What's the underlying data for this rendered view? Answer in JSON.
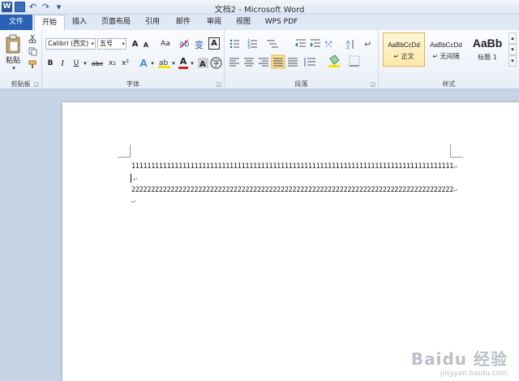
{
  "window": {
    "title": "文档2 - Microsoft Word"
  },
  "qat": {
    "logo": "W",
    "undo": "↶",
    "redo": "↷",
    "more": "▾"
  },
  "tabs": [
    {
      "label": "文件"
    },
    {
      "label": "开始"
    },
    {
      "label": "插入"
    },
    {
      "label": "页面布局"
    },
    {
      "label": "引用"
    },
    {
      "label": "邮件"
    },
    {
      "label": "审阅"
    },
    {
      "label": "视图"
    },
    {
      "label": "WPS PDF"
    }
  ],
  "ribbon": {
    "clipboard": {
      "label": "剪贴板",
      "paste_label": "粘贴"
    },
    "font": {
      "label": "字体",
      "font_name": "Calibri (西文)",
      "font_size": "五号",
      "grow": "A",
      "shrink": "A",
      "case": "Aa",
      "bold": "B",
      "italic": "I",
      "underline": "U",
      "strike": "abc",
      "subscript": "x₂",
      "superscript": "x²",
      "text_effect": "A",
      "font_color": "A"
    },
    "paragraph": {
      "label": "段落"
    },
    "styles": {
      "label": "样式",
      "items": [
        {
          "sample": "AaBbCcDd",
          "name": "↵ 正文"
        },
        {
          "sample": "AaBbCcDd",
          "name": "↵ 无间隔"
        },
        {
          "sample": "AaBb",
          "name": "标题 1"
        }
      ]
    }
  },
  "document": {
    "line1": "1111111111111111111111111111111111111111111111111111111111111111111111111111111111",
    "line2": "2222222222222222222222222222222222222222222222222222222222222222222222222222222222",
    "para_mark": "↵"
  },
  "watermark": {
    "main": "Baidu 经验",
    "sub": "jingyan.baidu.com"
  },
  "colors": {
    "file_tab": "#2a62b6",
    "highlight": "#f5e400",
    "font_color": "#d0281e"
  }
}
